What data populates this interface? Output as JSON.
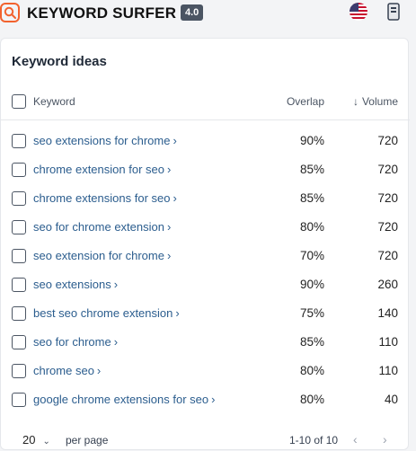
{
  "header": {
    "brand": "KEYWORD SURFER",
    "version": "4.0",
    "icons": [
      "surfer-logo-icon",
      "us-flag-icon",
      "phone-icon"
    ]
  },
  "card": {
    "title": "Keyword ideas",
    "columns": {
      "keyword": "Keyword",
      "overlap": "Overlap",
      "volume": "Volume"
    },
    "sort_indicator": "↓",
    "rows": [
      {
        "keyword": "seo extensions for chrome",
        "overlap": "90%",
        "volume": "720"
      },
      {
        "keyword": "chrome extension for seo",
        "overlap": "85%",
        "volume": "720"
      },
      {
        "keyword": "chrome extensions for seo",
        "overlap": "85%",
        "volume": "720"
      },
      {
        "keyword": "seo for chrome extension",
        "overlap": "80%",
        "volume": "720"
      },
      {
        "keyword": "seo extension for chrome",
        "overlap": "70%",
        "volume": "720"
      },
      {
        "keyword": "seo extensions",
        "overlap": "90%",
        "volume": "260"
      },
      {
        "keyword": "best seo chrome extension",
        "overlap": "75%",
        "volume": "140"
      },
      {
        "keyword": "seo for chrome",
        "overlap": "85%",
        "volume": "110"
      },
      {
        "keyword": "chrome seo",
        "overlap": "80%",
        "volume": "110"
      },
      {
        "keyword": "google chrome extensions for seo",
        "overlap": "80%",
        "volume": "40"
      }
    ]
  },
  "footer": {
    "per_page_value": "20",
    "per_page_label": "per page",
    "range": "1-10 of 10",
    "prev": "‹",
    "next": "›"
  },
  "colors": {
    "keyword_link": "#2b5d8e",
    "brand_accent": "#f2622e",
    "badge_bg": "#4b5563"
  }
}
